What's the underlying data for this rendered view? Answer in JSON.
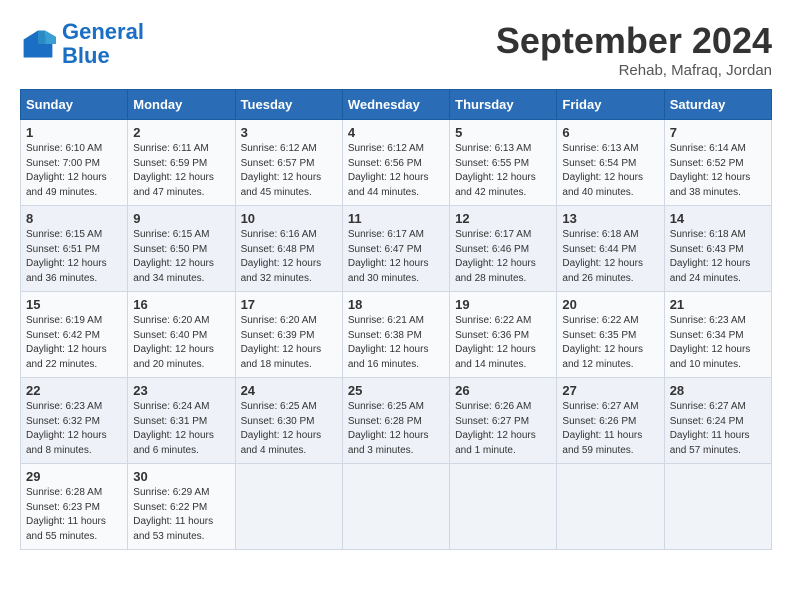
{
  "header": {
    "logo_line1": "General",
    "logo_line2": "Blue",
    "month": "September 2024",
    "location": "Rehab, Mafraq, Jordan"
  },
  "days_of_week": [
    "Sunday",
    "Monday",
    "Tuesday",
    "Wednesday",
    "Thursday",
    "Friday",
    "Saturday"
  ],
  "weeks": [
    [
      {
        "day": "1",
        "info": "Sunrise: 6:10 AM\nSunset: 7:00 PM\nDaylight: 12 hours\nand 49 minutes."
      },
      {
        "day": "2",
        "info": "Sunrise: 6:11 AM\nSunset: 6:59 PM\nDaylight: 12 hours\nand 47 minutes."
      },
      {
        "day": "3",
        "info": "Sunrise: 6:12 AM\nSunset: 6:57 PM\nDaylight: 12 hours\nand 45 minutes."
      },
      {
        "day": "4",
        "info": "Sunrise: 6:12 AM\nSunset: 6:56 PM\nDaylight: 12 hours\nand 44 minutes."
      },
      {
        "day": "5",
        "info": "Sunrise: 6:13 AM\nSunset: 6:55 PM\nDaylight: 12 hours\nand 42 minutes."
      },
      {
        "day": "6",
        "info": "Sunrise: 6:13 AM\nSunset: 6:54 PM\nDaylight: 12 hours\nand 40 minutes."
      },
      {
        "day": "7",
        "info": "Sunrise: 6:14 AM\nSunset: 6:52 PM\nDaylight: 12 hours\nand 38 minutes."
      }
    ],
    [
      {
        "day": "8",
        "info": "Sunrise: 6:15 AM\nSunset: 6:51 PM\nDaylight: 12 hours\nand 36 minutes."
      },
      {
        "day": "9",
        "info": "Sunrise: 6:15 AM\nSunset: 6:50 PM\nDaylight: 12 hours\nand 34 minutes."
      },
      {
        "day": "10",
        "info": "Sunrise: 6:16 AM\nSunset: 6:48 PM\nDaylight: 12 hours\nand 32 minutes."
      },
      {
        "day": "11",
        "info": "Sunrise: 6:17 AM\nSunset: 6:47 PM\nDaylight: 12 hours\nand 30 minutes."
      },
      {
        "day": "12",
        "info": "Sunrise: 6:17 AM\nSunset: 6:46 PM\nDaylight: 12 hours\nand 28 minutes."
      },
      {
        "day": "13",
        "info": "Sunrise: 6:18 AM\nSunset: 6:44 PM\nDaylight: 12 hours\nand 26 minutes."
      },
      {
        "day": "14",
        "info": "Sunrise: 6:18 AM\nSunset: 6:43 PM\nDaylight: 12 hours\nand 24 minutes."
      }
    ],
    [
      {
        "day": "15",
        "info": "Sunrise: 6:19 AM\nSunset: 6:42 PM\nDaylight: 12 hours\nand 22 minutes."
      },
      {
        "day": "16",
        "info": "Sunrise: 6:20 AM\nSunset: 6:40 PM\nDaylight: 12 hours\nand 20 minutes."
      },
      {
        "day": "17",
        "info": "Sunrise: 6:20 AM\nSunset: 6:39 PM\nDaylight: 12 hours\nand 18 minutes."
      },
      {
        "day": "18",
        "info": "Sunrise: 6:21 AM\nSunset: 6:38 PM\nDaylight: 12 hours\nand 16 minutes."
      },
      {
        "day": "19",
        "info": "Sunrise: 6:22 AM\nSunset: 6:36 PM\nDaylight: 12 hours\nand 14 minutes."
      },
      {
        "day": "20",
        "info": "Sunrise: 6:22 AM\nSunset: 6:35 PM\nDaylight: 12 hours\nand 12 minutes."
      },
      {
        "day": "21",
        "info": "Sunrise: 6:23 AM\nSunset: 6:34 PM\nDaylight: 12 hours\nand 10 minutes."
      }
    ],
    [
      {
        "day": "22",
        "info": "Sunrise: 6:23 AM\nSunset: 6:32 PM\nDaylight: 12 hours\nand 8 minutes."
      },
      {
        "day": "23",
        "info": "Sunrise: 6:24 AM\nSunset: 6:31 PM\nDaylight: 12 hours\nand 6 minutes."
      },
      {
        "day": "24",
        "info": "Sunrise: 6:25 AM\nSunset: 6:30 PM\nDaylight: 12 hours\nand 4 minutes."
      },
      {
        "day": "25",
        "info": "Sunrise: 6:25 AM\nSunset: 6:28 PM\nDaylight: 12 hours\nand 3 minutes."
      },
      {
        "day": "26",
        "info": "Sunrise: 6:26 AM\nSunset: 6:27 PM\nDaylight: 12 hours\nand 1 minute."
      },
      {
        "day": "27",
        "info": "Sunrise: 6:27 AM\nSunset: 6:26 PM\nDaylight: 11 hours\nand 59 minutes."
      },
      {
        "day": "28",
        "info": "Sunrise: 6:27 AM\nSunset: 6:24 PM\nDaylight: 11 hours\nand 57 minutes."
      }
    ],
    [
      {
        "day": "29",
        "info": "Sunrise: 6:28 AM\nSunset: 6:23 PM\nDaylight: 11 hours\nand 55 minutes."
      },
      {
        "day": "30",
        "info": "Sunrise: 6:29 AM\nSunset: 6:22 PM\nDaylight: 11 hours\nand 53 minutes."
      },
      null,
      null,
      null,
      null,
      null
    ]
  ]
}
